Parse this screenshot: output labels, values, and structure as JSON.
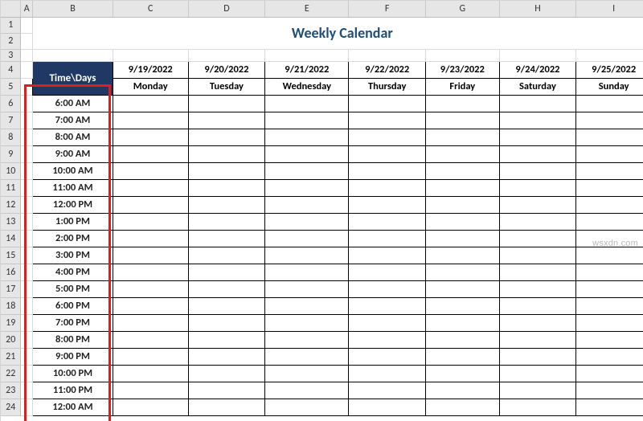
{
  "watermark": "wsxdn.com",
  "columns": [
    "A",
    "B",
    "C",
    "D",
    "E",
    "F",
    "G",
    "H",
    "I"
  ],
  "rownums": [
    "1",
    "2",
    "3",
    "4",
    "5",
    "6",
    "7",
    "8",
    "9",
    "10",
    "11",
    "12",
    "13",
    "14",
    "15",
    "16",
    "17",
    "18",
    "19",
    "20",
    "21",
    "22",
    "23",
    "24"
  ],
  "title": "Weekly Calendar",
  "corner_label": "Time\\Days",
  "dates": [
    "9/19/2022",
    "9/20/2022",
    "9/21/2022",
    "9/22/2022",
    "9/23/2022",
    "9/24/2022",
    "9/25/2022"
  ],
  "days": [
    "Monday",
    "Tuesday",
    "Wednesday",
    "Thursday",
    "Friday",
    "Saturday",
    "Sunday"
  ],
  "times": [
    "6:00 AM",
    "7:00 AM",
    "8:00 AM",
    "9:00 AM",
    "10:00 AM",
    "11:00 AM",
    "12:00 PM",
    "1:00 PM",
    "2:00 PM",
    "3:00 PM",
    "4:00 PM",
    "5:00 PM",
    "6:00 PM",
    "7:00 PM",
    "8:00 PM",
    "9:00 PM",
    "10:00 PM",
    "11:00 PM",
    "12:00 AM"
  ],
  "chart_data": {
    "type": "table",
    "title": "Weekly Calendar",
    "row_header": "Time\\Days",
    "columns": [
      {
        "date": "9/19/2022",
        "day": "Monday"
      },
      {
        "date": "9/20/2022",
        "day": "Tuesday"
      },
      {
        "date": "9/21/2022",
        "day": "Wednesday"
      },
      {
        "date": "9/22/2022",
        "day": "Thursday"
      },
      {
        "date": "9/23/2022",
        "day": "Friday"
      },
      {
        "date": "9/24/2022",
        "day": "Saturday"
      },
      {
        "date": "9/25/2022",
        "day": "Sunday"
      }
    ],
    "rows": [
      "6:00 AM",
      "7:00 AM",
      "8:00 AM",
      "9:00 AM",
      "10:00 AM",
      "11:00 AM",
      "12:00 PM",
      "1:00 PM",
      "2:00 PM",
      "3:00 PM",
      "4:00 PM",
      "5:00 PM",
      "6:00 PM",
      "7:00 PM",
      "8:00 PM",
      "9:00 PM",
      "10:00 PM",
      "11:00 PM",
      "12:00 AM"
    ]
  }
}
